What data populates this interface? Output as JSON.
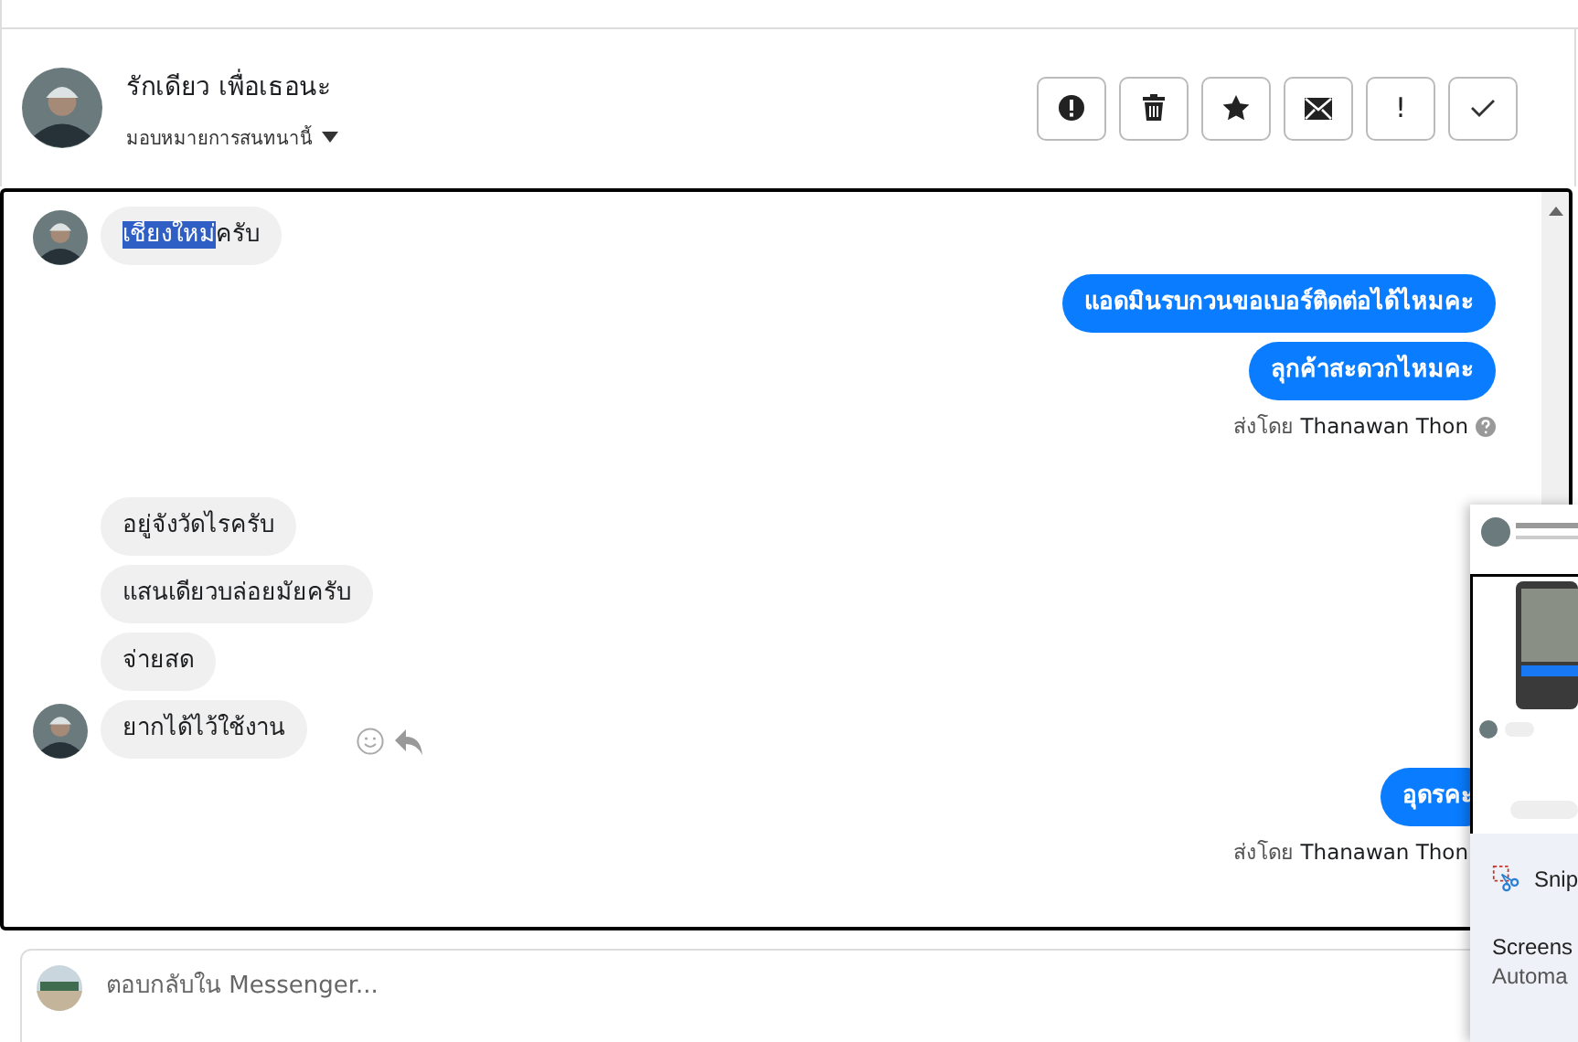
{
  "header": {
    "name": "รักเดียว เพื่อเธอนะ",
    "assign": "มอบหมายการสนทนานี้",
    "actions": [
      {
        "kind": "alert"
      },
      {
        "kind": "trash"
      },
      {
        "kind": "star"
      },
      {
        "kind": "mail"
      },
      {
        "kind": "exclaim",
        "label": "!"
      },
      {
        "kind": "check"
      }
    ]
  },
  "messages": [
    {
      "kind": "in",
      "avatar": true,
      "parts": [
        {
          "text": "เชียงใหม่",
          "highlighted": true
        },
        {
          "text": "ครับ",
          "highlighted": false
        }
      ]
    },
    {
      "kind": "out",
      "parts": [
        {
          "text": "แอดมินรบกวนขอเบอร์ติดต่อได้ไหมคะ",
          "highlighted": false
        }
      ]
    },
    {
      "kind": "out",
      "parts": [
        {
          "text": "ลุกค้าสะดวกไหมคะ",
          "highlighted": false
        }
      ]
    },
    {
      "kind": "sent",
      "prefix": "ส่งโดย",
      "sender": "Thanawan Thon",
      "help": true
    },
    {
      "kind": "in",
      "avatar": false,
      "parts": [
        {
          "text": "อยู่จังวัดไรครับ",
          "highlighted": false
        }
      ]
    },
    {
      "kind": "in",
      "avatar": false,
      "parts": [
        {
          "text": "แสนเดียวบล่อยมัยครับ",
          "highlighted": false
        }
      ]
    },
    {
      "kind": "in",
      "avatar": false,
      "parts": [
        {
          "text": "จ่ายสด",
          "highlighted": false
        }
      ]
    },
    {
      "kind": "in",
      "avatar": true,
      "reactions": true,
      "parts": [
        {
          "text": "ยากได้ไว้ใช้งาน",
          "highlighted": false
        }
      ]
    },
    {
      "kind": "out",
      "parts": [
        {
          "text": "อุดรคะ",
          "highlighted": false
        }
      ]
    },
    {
      "kind": "sent",
      "prefix": "ส่งโดย",
      "sender": "Thanawan Thon",
      "help": false
    }
  ],
  "composer": {
    "placeholder": "ตอบกลับใน Messenger..."
  },
  "snip_notification": {
    "app": "Snip",
    "title": "Screens",
    "body": "Automa"
  }
}
